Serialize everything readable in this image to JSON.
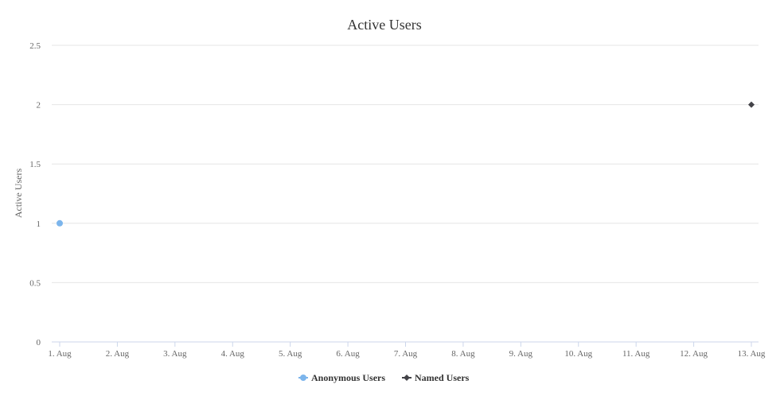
{
  "chart_data": {
    "type": "line",
    "title": "Active Users",
    "xlabel": "",
    "ylabel": "Active Users",
    "categories": [
      "1. Aug",
      "2. Aug",
      "3. Aug",
      "4. Aug",
      "5. Aug",
      "6. Aug",
      "7. Aug",
      "8. Aug",
      "9. Aug",
      "10. Aug",
      "11. Aug",
      "12. Aug",
      "13. Aug"
    ],
    "yticks": [
      "0",
      "0.5",
      "1",
      "1.5",
      "2",
      "2.5"
    ],
    "ylim": [
      0,
      2.5
    ],
    "grid": true,
    "legend_position": "bottom-center",
    "series": [
      {
        "name": "Anonymous Users",
        "color": "#7cb5ec",
        "marker": "circle",
        "points": [
          {
            "x": "1. Aug",
            "y": 1
          }
        ]
      },
      {
        "name": "Named Users",
        "color": "#434348",
        "marker": "diamond",
        "points": [
          {
            "x": "13. Aug",
            "y": 2
          }
        ]
      }
    ]
  }
}
